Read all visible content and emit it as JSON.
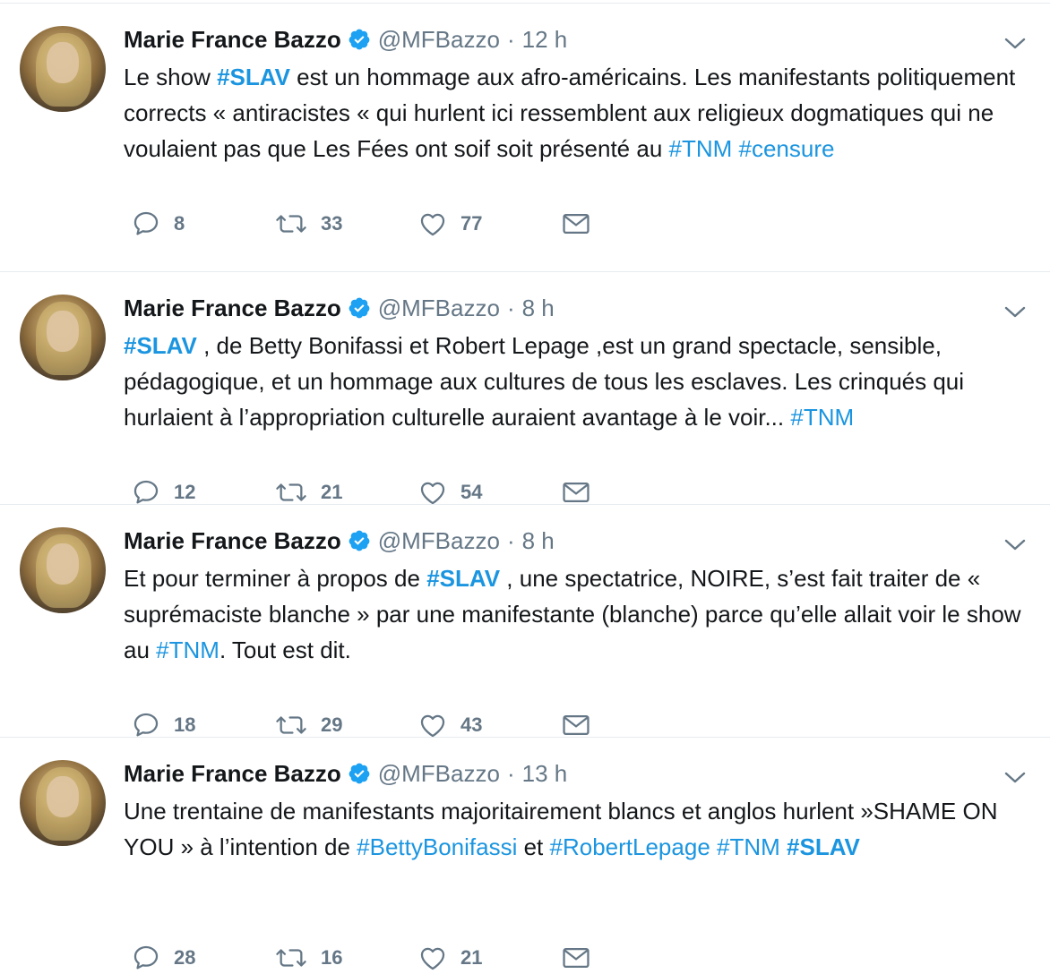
{
  "tweets": [
    {
      "author": "Marie France Bazzo",
      "handle": "@MFBazzo",
      "dot": "·",
      "time": "12 h",
      "segments": [
        {
          "t": "Le show "
        },
        {
          "t": "#SLAV",
          "tag": true,
          "bold": true
        },
        {
          "t": " est un hommage aux afro-américains. Les manifestants politiquement corrects « antiracistes «  qui hurlent ici ressemblent aux religieux dogmatiques qui ne voulaient pas que Les Fées ont soif soit présenté au "
        },
        {
          "t": "#TNM",
          "tag": true
        },
        {
          "t": " "
        },
        {
          "t": "#censure",
          "tag": true
        }
      ],
      "replies": "8",
      "retweets": "33",
      "likes": "77"
    },
    {
      "author": "Marie France Bazzo",
      "handle": "@MFBazzo",
      "dot": "·",
      "time": "8 h",
      "segments": [
        {
          "t": "#SLAV",
          "tag": true,
          "bold": true
        },
        {
          "t": " , de Betty Bonifassi et Robert Lepage ,est un grand spectacle, sensible, pédagogique, et un hommage aux cultures de tous les esclaves. Les crinqués qui hurlaient à l’appropriation culturelle auraient avantage à le voir... "
        },
        {
          "t": "#TNM",
          "tag": true
        }
      ],
      "replies": "12",
      "retweets": "21",
      "likes": "54"
    },
    {
      "author": "Marie France Bazzo",
      "handle": "@MFBazzo",
      "dot": "·",
      "time": "8 h",
      "segments": [
        {
          "t": "Et pour terminer à propos de "
        },
        {
          "t": "#SLAV",
          "tag": true,
          "bold": true
        },
        {
          "t": " , une spectatrice, NOIRE, s’est fait traiter de « suprémaciste blanche » par une manifestante (blanche) parce qu’elle allait voir le show au "
        },
        {
          "t": "#TNM",
          "tag": true
        },
        {
          "t": ". Tout est dit."
        }
      ],
      "replies": "18",
      "retweets": "29",
      "likes": "43"
    },
    {
      "author": "Marie France Bazzo",
      "handle": "@MFBazzo",
      "dot": "·",
      "time": "13 h",
      "segments": [
        {
          "t": "Une trentaine de manifestants majoritairement blancs et anglos hurlent »SHAME ON YOU » à l’intention de "
        },
        {
          "t": "#BettyBonifassi",
          "tag": true
        },
        {
          "t": " et "
        },
        {
          "t": "#RobertLepage",
          "tag": true
        },
        {
          "t": " "
        },
        {
          "t": "#TNM",
          "tag": true
        },
        {
          "t": " "
        },
        {
          "t": "#SLAV",
          "tag": true,
          "bold": true
        }
      ],
      "replies": "28",
      "retweets": "16",
      "likes": "21"
    }
  ],
  "icons": {
    "verified": "verified-badge-icon",
    "chevron": "chevron-down-icon",
    "reply": "reply-icon",
    "retweet": "retweet-icon",
    "like": "heart-icon",
    "dm": "envelope-icon"
  },
  "colors": {
    "link": "#1b95e0",
    "muted": "#657786",
    "text": "#14171a",
    "verified": "#1da1f2",
    "divider": "#e6ecf0"
  }
}
